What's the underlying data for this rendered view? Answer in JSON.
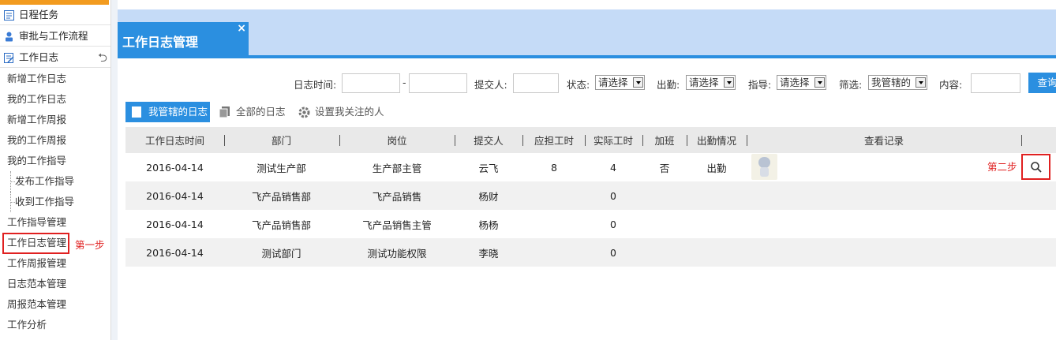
{
  "sidebar": {
    "sections": [
      {
        "label": "日程任务"
      },
      {
        "label": "审批与工作流程"
      },
      {
        "label": "工作日志"
      }
    ],
    "items": [
      {
        "label": "新增工作日志"
      },
      {
        "label": "我的工作日志"
      },
      {
        "label": "新增工作周报"
      },
      {
        "label": "我的工作周报"
      },
      {
        "label": "我的工作指导"
      },
      {
        "label": "发布工作指导"
      },
      {
        "label": "收到工作指导"
      },
      {
        "label": "工作指导管理"
      },
      {
        "label": "工作日志管理"
      },
      {
        "label": "工作周报管理"
      },
      {
        "label": "日志范本管理"
      },
      {
        "label": "周报范本管理"
      },
      {
        "label": "工作分析"
      }
    ],
    "step1": "第一步"
  },
  "header": {
    "tab_title": "工作日志管理",
    "close": "×"
  },
  "filters": {
    "date_label": "日志时间:",
    "date_sep": "-",
    "submitter_label": "提交人:",
    "status_label": "状态:",
    "status_value": "请选择",
    "attendance_label": "出勤:",
    "attendance_value": "请选择",
    "guide_label": "指导:",
    "guide_value": "请选择",
    "filter_label": "筛选:",
    "filter_value": "我管辖的",
    "content_label": "内容:",
    "query_button": "查询"
  },
  "subtabs": {
    "my": "我管辖的日志",
    "all": "全部的日志",
    "follow": "设置我关注的人"
  },
  "table": {
    "headers": [
      "工作日志时间",
      "部门",
      "岗位",
      "提交人",
      "应担工时",
      "实际工时",
      "加班",
      "出勤情况",
      "查看记录"
    ],
    "rows": [
      [
        "2016-04-14",
        "测试生产部",
        "生产部主管",
        "云飞",
        "8",
        "4",
        "否",
        "出勤"
      ],
      [
        "2016-04-14",
        "飞产品销售部",
        "飞产品销售",
        "杨财",
        "",
        "0",
        "",
        ""
      ],
      [
        "2016-04-14",
        "飞产品销售部",
        "飞产品销售主管",
        "杨杨",
        "",
        "0",
        "",
        ""
      ],
      [
        "2016-04-14",
        "测试部门",
        "测试功能权限",
        "李晓",
        "",
        "0",
        "",
        ""
      ]
    ],
    "step2": "第二步"
  },
  "colors": {
    "accent": "#2b8fe0",
    "header_bg": "#c5dbf7",
    "highlight": "#e02020"
  }
}
